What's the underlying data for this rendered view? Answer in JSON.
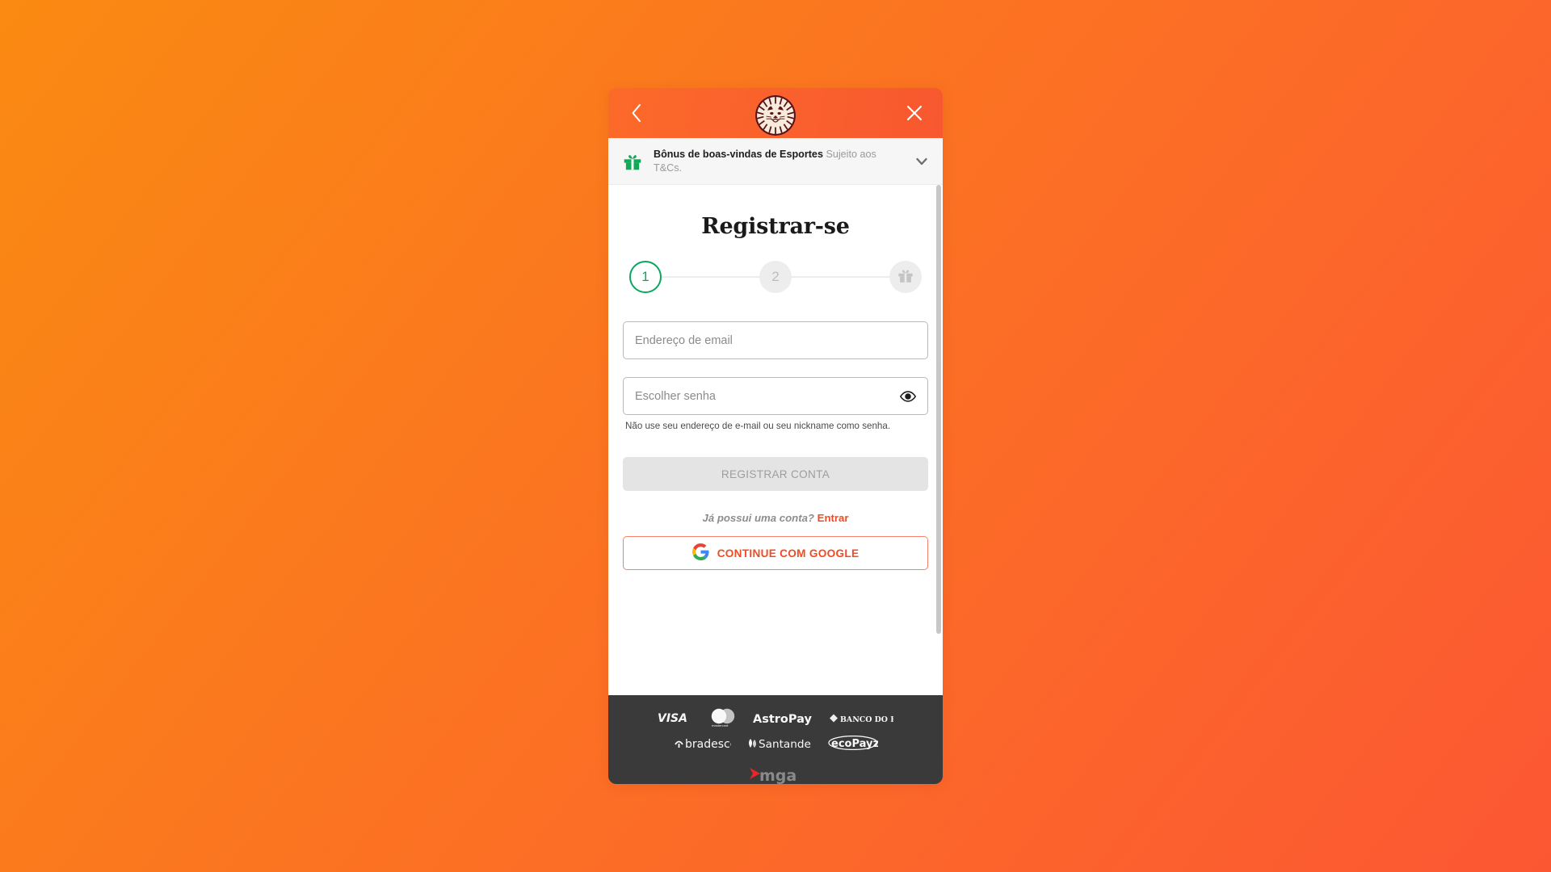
{
  "background": {
    "from": "#FA8A12",
    "to": "#FC5733"
  },
  "header": {
    "back_label": "Voltar",
    "close_label": "Fechar",
    "logo_name": "LeoVegas"
  },
  "bonus_banner": {
    "title": "Bônus de boas-vindas de Esportes",
    "subtitle": "Sujeito aos T&Cs.",
    "gift_icon": "gift-icon",
    "chevron_icon": "chevron-down-icon",
    "gift_color": "#0FA958"
  },
  "main": {
    "title": "Registrar-se",
    "stepper": {
      "steps": [
        {
          "label": "1",
          "state": "active"
        },
        {
          "label": "2",
          "state": "idle"
        },
        {
          "label": "",
          "state": "gift",
          "icon": "gift-icon"
        }
      ],
      "active_color": "#0aa65f"
    },
    "email_field": {
      "placeholder": "Endereço de email",
      "value": ""
    },
    "password_field": {
      "placeholder": "Escolher senha",
      "value": "",
      "toggle_icon": "eye-icon"
    },
    "password_hint": "Não use seu endereço de e-mail ou seu nickname como senha.",
    "submit_label": "REGISTRAR CONTA",
    "login_prompt": "Já possui uma conta?",
    "login_link": "Entrar",
    "google_button": {
      "label": "CONTINUE COM GOOGLE",
      "icon": "google-g-icon"
    },
    "accent_color": "#F04B23"
  },
  "footer": {
    "payments_row1": [
      "VISA",
      "mastercard",
      "AstroPay",
      "BANCO DO BRASIL"
    ],
    "payments_row2": [
      "bradesco",
      "Santander",
      "ecoPayz"
    ],
    "license": "mga"
  }
}
